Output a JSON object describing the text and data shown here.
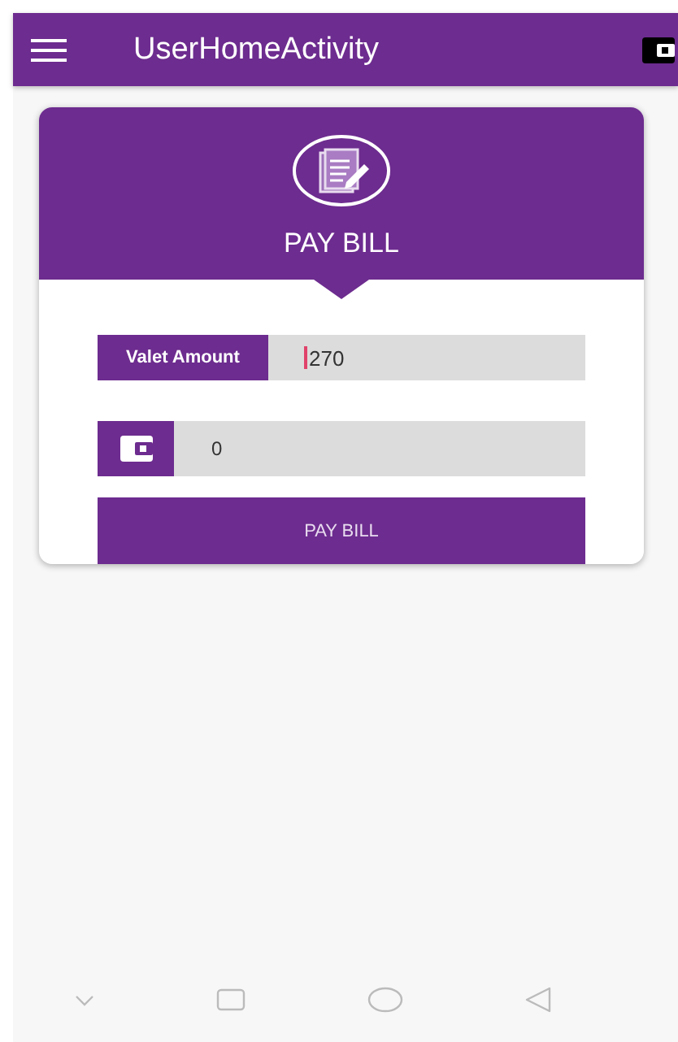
{
  "app_bar": {
    "title": "UserHomeActivity"
  },
  "card": {
    "title": "PAY BILL",
    "amount_field": {
      "label": "Valet Amount",
      "value": "270"
    },
    "wallet_field": {
      "value": "0"
    },
    "button": "PAY BILL"
  }
}
